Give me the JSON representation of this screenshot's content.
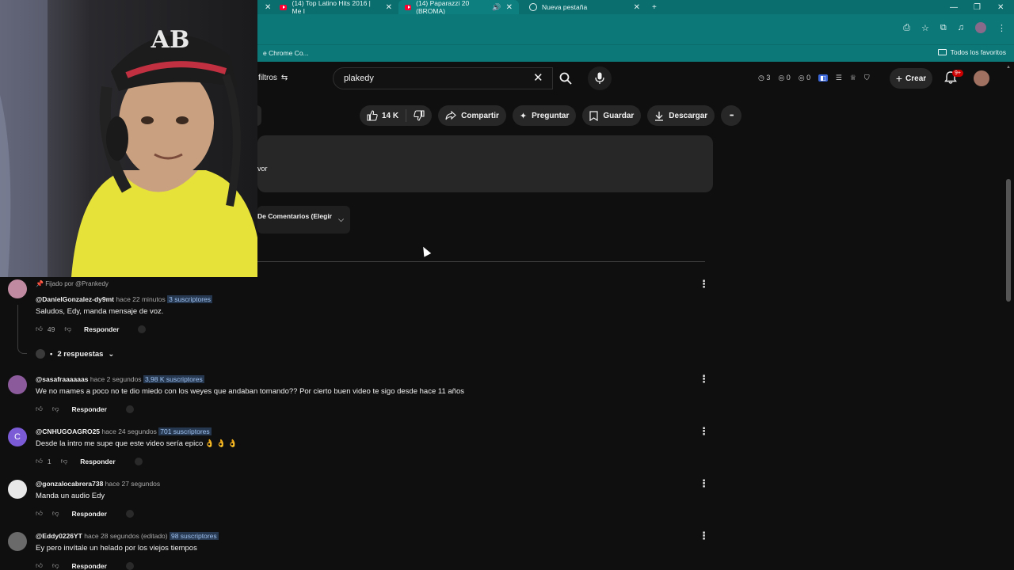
{
  "browser": {
    "tabs": [
      {
        "label": "(14) Top Latino Hits 2016 | Me I",
        "type": "youtube"
      },
      {
        "label": "(14) Paparazzi 20 (BROMA)",
        "type": "youtube-audio"
      },
      {
        "label": "Nueva pestaña",
        "type": "newtab"
      }
    ],
    "new_tab_symbol": "+",
    "bookmark_left": "e Chrome Co...",
    "bookmark_right": "Todos los favoritos"
  },
  "header": {
    "filters_label": "filtros",
    "search_value": "plakedy",
    "ext_stats": [
      "3",
      "0",
      "0"
    ],
    "create_label": "Crear",
    "notifications_badge": "9+"
  },
  "actions": {
    "likes": "14 K",
    "share": "Compartir",
    "ask": "Preguntar",
    "save": "Guardar",
    "download": "Descargar",
    "more": "•••"
  },
  "description": {
    "text_fragment": "vor"
  },
  "sort": {
    "label": "De Comentarios (Elegir"
  },
  "comments": [
    {
      "pinned": "Fijado por @Prankedy",
      "handle": "@DanielGonzalez-dy9mt",
      "time": "hace 22 minutos",
      "subs": "3 suscriptores",
      "text": "Saludos, Edy, manda mensaje de voz.",
      "likes": "49",
      "reply": "Responder",
      "avatar_color": "#c08aa0",
      "replies": "2 respuestas"
    },
    {
      "handle": "@sasafraaaaaas",
      "time": "hace 2 segundos",
      "subs": "3,98 K suscriptores",
      "text": "We no mames a poco no te dio miedo con los weyes que andaban tomando?? Por cierto buen video te sigo desde hace 11 años",
      "likes": "",
      "reply": "Responder",
      "avatar_color": "#8a5a9a"
    },
    {
      "handle": "@CNHUGOAGRO25",
      "time": "hace 24 segundos",
      "subs": "701 suscriptores",
      "text": "Desde la intro me supe que este video sería epico 👌 👌 👌",
      "likes": "1",
      "reply": "Responder",
      "avatar_color": "#7b5cd6",
      "avatar_letter": "C"
    },
    {
      "handle": "@gonzalocabrera738",
      "time": "hace 27 segundos",
      "subs": "",
      "text": "Manda un audio Edy",
      "likes": "",
      "reply": "Responder",
      "avatar_color": "#e8e8e8"
    },
    {
      "handle": "@Eddy0226YT",
      "time": "hace 28 segundos (editado)",
      "subs": "98 suscriptores",
      "text": "Ey pero invítale un helado por los viejos tiempos",
      "likes": "",
      "reply": "Responder",
      "avatar_color": "#6a6a6a"
    }
  ]
}
